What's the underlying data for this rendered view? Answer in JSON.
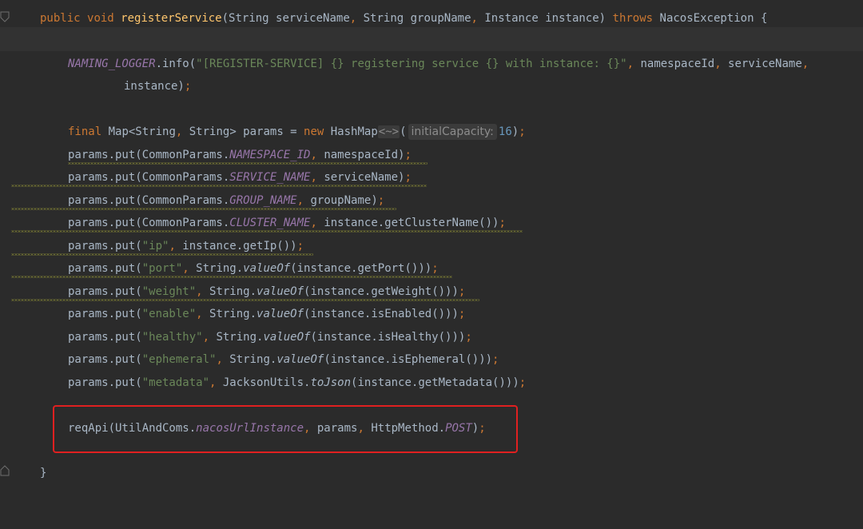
{
  "editor": {
    "lines": {
      "sig": {
        "t1": "public",
        "t2": " ",
        "t3": "void",
        "t4": " ",
        "t5": "registerService",
        "t6": "(String serviceName",
        "t7": ",",
        "t8": " String groupName",
        "t9": ",",
        "t10": " Instance instance) ",
        "t11": "throws",
        "t12": " NacosException {"
      },
      "log1": {
        "t1": "NAMING_LOGGER",
        "t2": ".info(",
        "t3": "\"[REGISTER-SERVICE] {} registering service {} with instance: {}\"",
        "t4": ",",
        "t5": " namespaceId",
        "t6": ",",
        "t7": " serviceName",
        "t8": ","
      },
      "log2": {
        "t1": "instance)",
        "t2": ";"
      },
      "map": {
        "t1": "final",
        "t2": " Map<String",
        "t3": ",",
        "t4": " String> params = ",
        "t5": "new",
        "t6": " HashMap",
        "t7": "<~>",
        "t8": "(",
        "hint": "initialCapacity:",
        "t9": "16",
        "t10": ")",
        "t11": ";"
      },
      "p1": {
        "t1": "params.put(CommonParams.",
        "t2": "NAMESPACE_ID",
        "t3": ",",
        "t4": " namespaceId)",
        "t5": ";"
      },
      "p2": {
        "t1": "params.put(CommonParams.",
        "t2": "SERVICE_NAME",
        "t3": ",",
        "t4": " serviceName)",
        "t5": ";"
      },
      "p3": {
        "t1": "params.put(CommonParams.",
        "t2": "GROUP_NAME",
        "t3": ",",
        "t4": " groupName)",
        "t5": ";"
      },
      "p4": {
        "t1": "params.put(CommonParams.",
        "t2": "CLUSTER_NAME",
        "t3": ",",
        "t4": " instance.getClusterName())",
        "t5": ";"
      },
      "p5": {
        "t1": "params.put(",
        "t2": "\"ip\"",
        "t3": ",",
        "t4": " instance.getIp())",
        "t5": ";"
      },
      "p6": {
        "t1": "params.put(",
        "t2": "\"port\"",
        "t3": ",",
        "t4": " String.",
        "t5": "valueOf",
        "t6": "(instance.getPort()))",
        "t7": ";"
      },
      "p7": {
        "t1": "params.put(",
        "t2": "\"weight\"",
        "t3": ",",
        "t4": " String.",
        "t5": "valueOf",
        "t6": "(instance.getWeight()))",
        "t7": ";"
      },
      "p8": {
        "t1": "params.put(",
        "t2": "\"enable\"",
        "t3": ",",
        "t4": " String.",
        "t5": "valueOf",
        "t6": "(instance.isEnabled()))",
        "t7": ";"
      },
      "p9": {
        "t1": "params.put(",
        "t2": "\"healthy\"",
        "t3": ",",
        "t4": " String.",
        "t5": "valueOf",
        "t6": "(instance.isHealthy()))",
        "t7": ";"
      },
      "p10": {
        "t1": "params.put(",
        "t2": "\"ephemeral\"",
        "t3": ",",
        "t4": " String.",
        "t5": "valueOf",
        "t6": "(instance.isEphemeral()))",
        "t7": ";"
      },
      "p11": {
        "t1": "params.put(",
        "t2": "\"metadata\"",
        "t3": ",",
        "t4": " JacksonUtils.",
        "t5": "toJson",
        "t6": "(instance.getMetadata()))",
        "t7": ";"
      },
      "req": {
        "t1": "reqApi(UtilAndComs.",
        "t2": "nacosUrlInstance",
        "t3": ",",
        "t4": " params",
        "t5": ",",
        "t6": " HttpMethod.",
        "t7": "POST",
        "t8": ")",
        "t9": ";"
      },
      "close": {
        "t1": "}"
      }
    },
    "colors": {
      "background": "#2b2b2b",
      "keyword": "#cc7832",
      "string": "#6a8759",
      "field": "#9876aa",
      "method_decl": "#ffc66d",
      "number": "#6897bb",
      "highlight_border": "#e02020"
    },
    "icons": [
      "fold-marker-icon"
    ]
  }
}
